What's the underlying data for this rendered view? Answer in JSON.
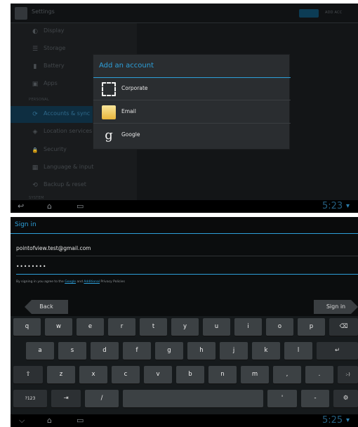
{
  "top": {
    "actionbar": {
      "title": "Settings",
      "add_label": "ADD ACC"
    },
    "settings_items": [
      {
        "label": "Display",
        "icon": "◐",
        "name": "display"
      },
      {
        "label": "Storage",
        "icon": "☰",
        "name": "storage"
      },
      {
        "label": "Battery",
        "icon": "▮",
        "name": "battery"
      },
      {
        "label": "Apps",
        "icon": "▣",
        "name": "apps"
      }
    ],
    "category_personal": "PERSONAL",
    "personal_items": [
      {
        "label": "Accounts & sync",
        "icon": "⟳",
        "name": "accounts-sync"
      },
      {
        "label": "Location services",
        "icon": "◈",
        "name": "location-services"
      },
      {
        "label": "Security",
        "icon": "🔒",
        "name": "security"
      },
      {
        "label": "Language & input",
        "icon": "▦",
        "name": "language-input"
      },
      {
        "label": "Backup & reset",
        "icon": "⟲",
        "name": "backup-reset"
      }
    ],
    "category_system": "SYSTEM",
    "clock": "5:23",
    "dialog": {
      "title": "Add an account",
      "accounts": [
        {
          "label": "Corporate",
          "icon": "corporate-icon"
        },
        {
          "label": "Email",
          "icon": "email-icon"
        },
        {
          "label": "Google",
          "icon": "google-icon"
        }
      ],
      "google_glyph": "g"
    }
  },
  "bottom": {
    "title": "Sign in",
    "email_value": "pointofview.test@gmail.com",
    "password_value": "••••••••",
    "legal": {
      "prefix": "By signing in you agree to the ",
      "google_link": "Google",
      "and": " and ",
      "additional_link": "Additional",
      "suffix": " Privacy Policies"
    },
    "back_label": "Back",
    "signin_label": "Sign in",
    "keyboard": {
      "row1": [
        "q",
        "w",
        "e",
        "r",
        "t",
        "y",
        "u",
        "i",
        "o",
        "p"
      ],
      "row2": [
        "a",
        "s",
        "d",
        "f",
        "g",
        "h",
        "j",
        "k",
        "l"
      ],
      "row3": [
        "z",
        "x",
        "c",
        "v",
        "b",
        "n",
        "m",
        ",",
        "."
      ],
      "shift": "⇧",
      "backspace": "⌫",
      "enter": "↵",
      "smiley": ":-)",
      "symbols": "?123",
      "tab": "⇥",
      "slash": "/",
      "apostrophe": "'",
      "dash": "-",
      "settings": "⚙"
    },
    "clock": "5:25"
  },
  "icons": {
    "back": "↩",
    "home": "⌂",
    "recent": "▭",
    "down": "⌵",
    "wifi": "▾"
  }
}
